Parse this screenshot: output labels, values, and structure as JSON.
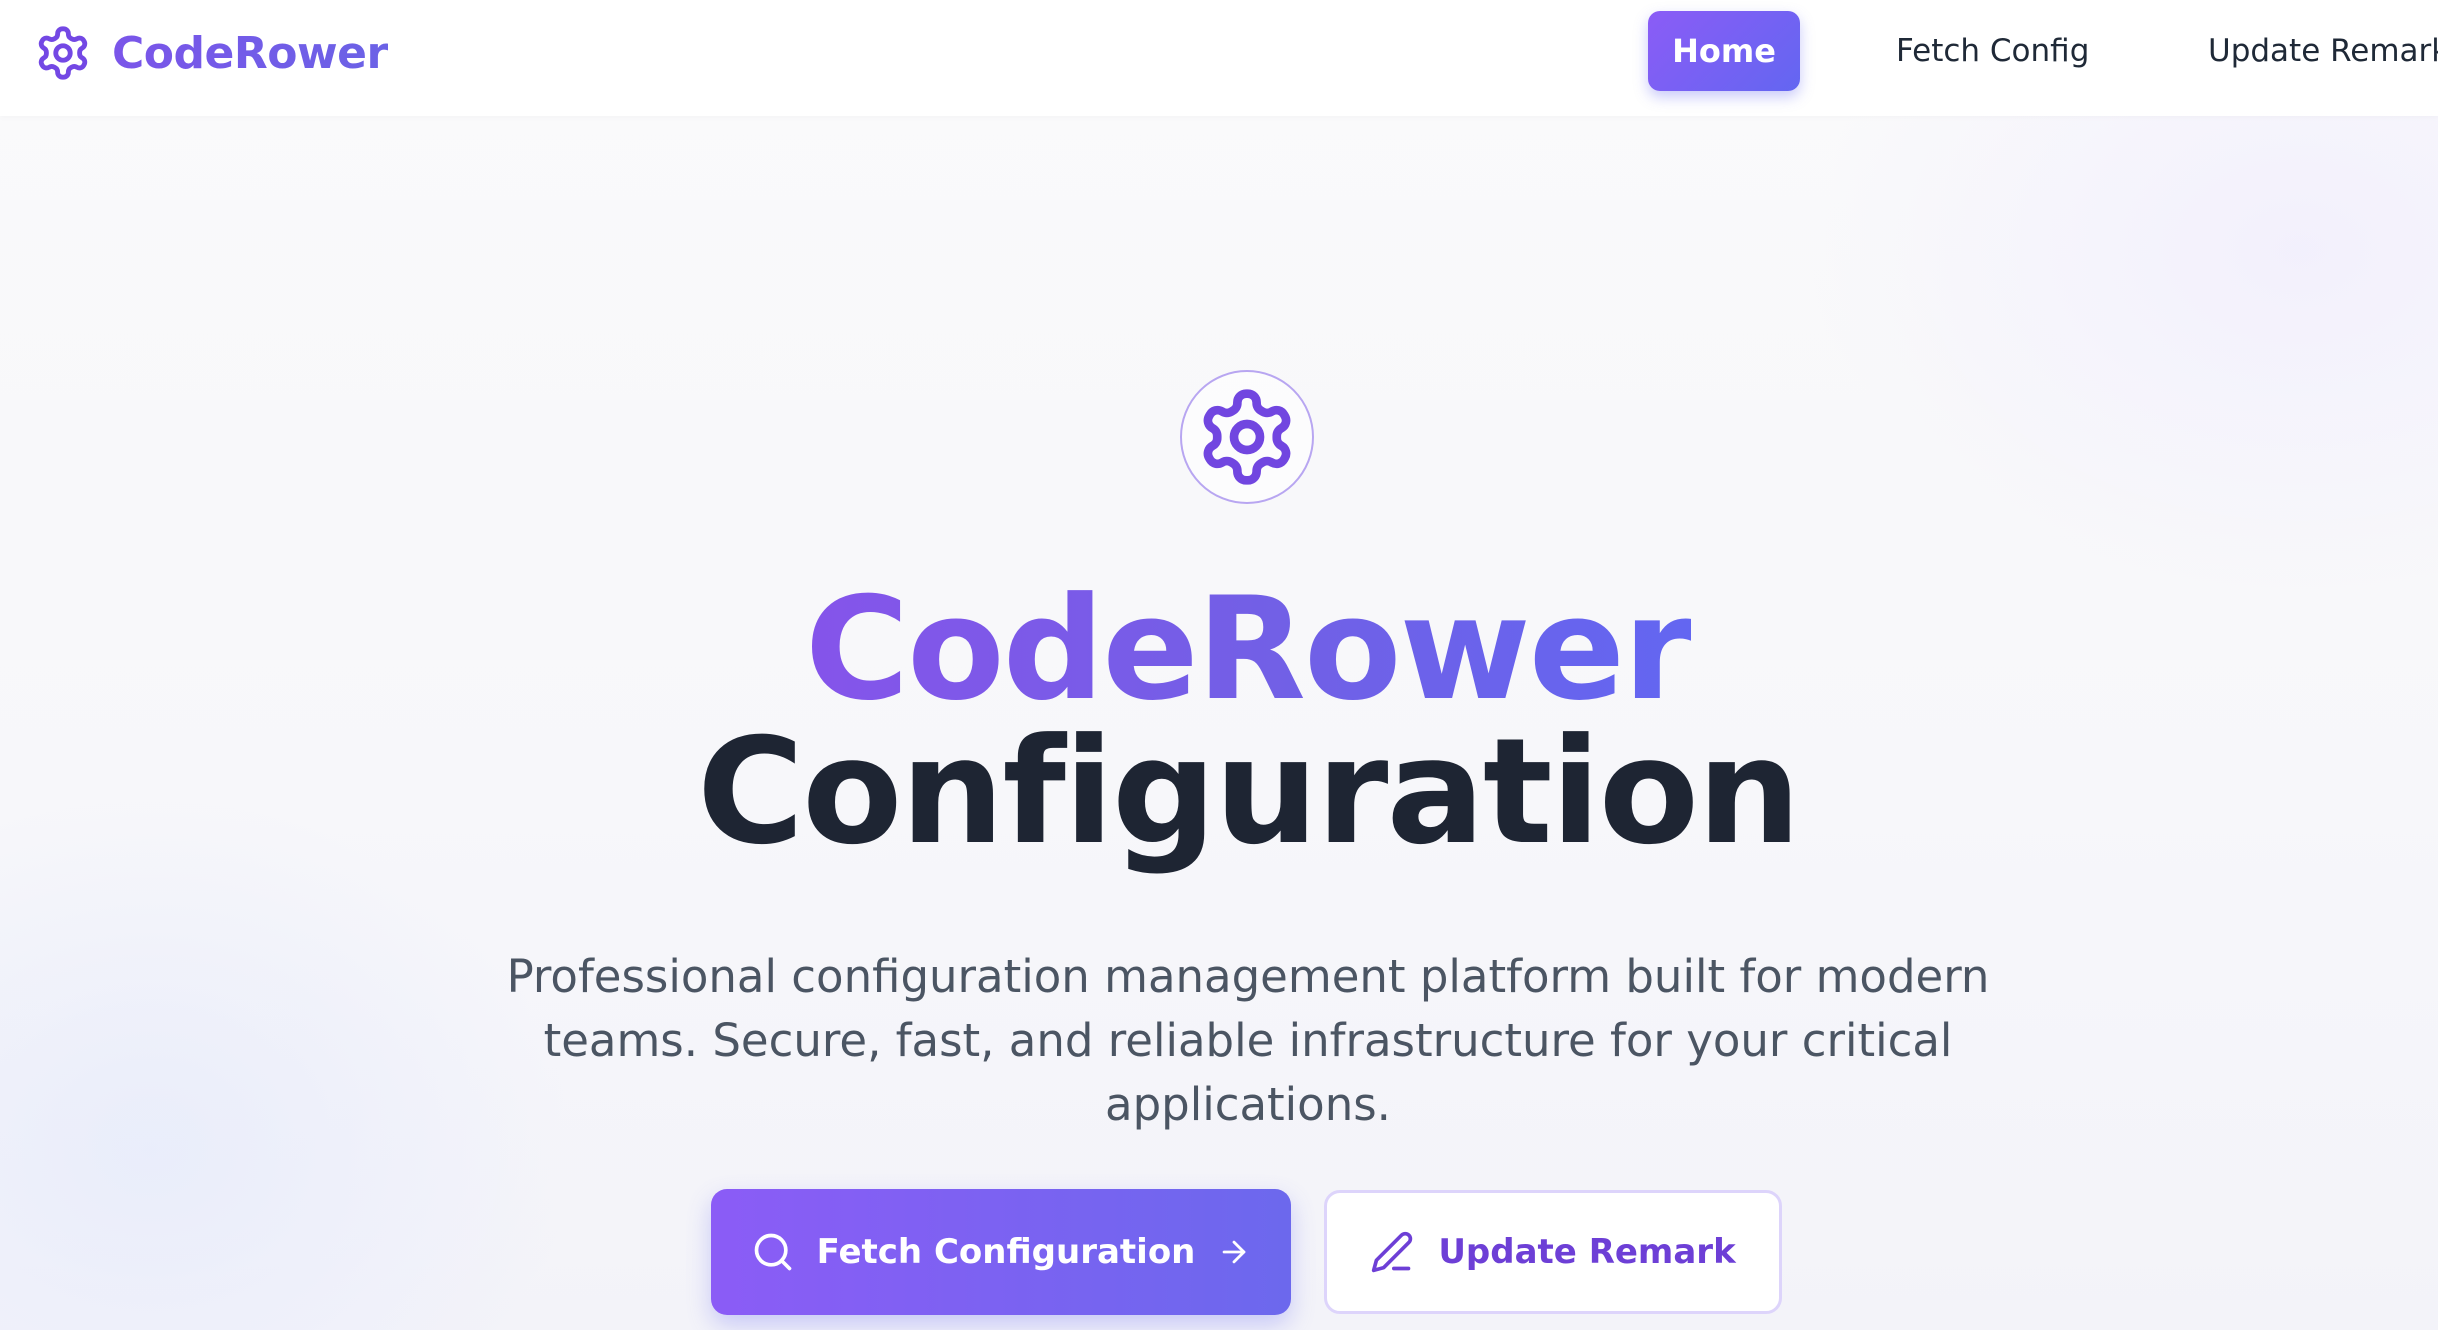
{
  "header": {
    "brand_name": "CodeRower",
    "brand_icon": "gear-icon",
    "nav": {
      "home": "Home",
      "fetch_config": "Fetch Config",
      "update_remark": "Update Remark"
    }
  },
  "hero": {
    "icon": "gear-icon",
    "title_line1": "CodeRower",
    "title_line2": "Configuration",
    "subtitle": "Professional configuration management platform built for modern teams. Secure, fast, and reliable infrastructure for your critical applications.",
    "primary_button": {
      "label": "Fetch Configuration",
      "icon": "search-icon",
      "trailing_icon": "arrow-right-icon"
    },
    "secondary_button": {
      "label": "Update Remark",
      "icon": "pencil-icon"
    }
  },
  "colors": {
    "accent_start": "#8b5cf6",
    "accent_end": "#6366f1",
    "heading_dark": "#1e2533",
    "body_text": "#4b5563"
  }
}
